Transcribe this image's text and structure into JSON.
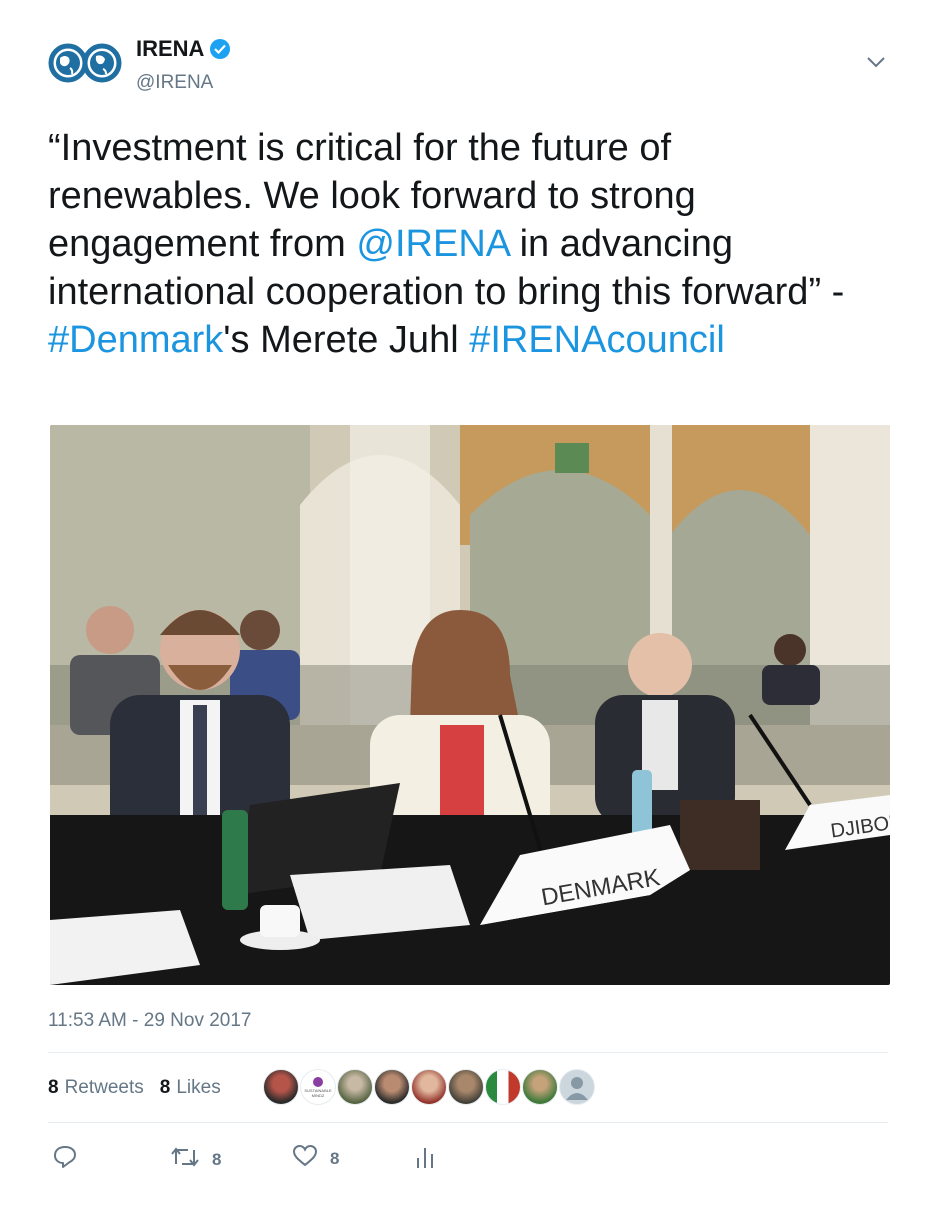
{
  "author": {
    "name": "IRENA",
    "handle": "@IRENA",
    "verified": true,
    "logo_icon": "irena-globe-logo"
  },
  "tweet": {
    "text_parts": [
      {
        "text": "“Investment is critical for the future of renewables. We look forward to strong engagement from ",
        "link": false
      },
      {
        "text": "@IRENA",
        "link": true
      },
      {
        "text": " in advancing international cooperation to bring this forward” - ",
        "link": false
      },
      {
        "text": "#Denmark",
        "link": true
      },
      {
        "text": "'s Merete Juhl ",
        "link": false
      },
      {
        "text": "#IRENAcouncil",
        "link": true
      }
    ],
    "photo": {
      "placards": [
        "DENMARK",
        "DJIBOU"
      ]
    },
    "timestamp": "11:53 AM - 29 Nov 2017"
  },
  "stats": {
    "retweets_count": "8",
    "retweets_label": "Retweets",
    "likes_count": "8",
    "likes_label": "Likes",
    "avatar_count": 9,
    "avatar_text": "SUSTAINABLE MINDZ"
  },
  "actions": {
    "reply_icon": "reply-icon",
    "retweet_icon": "retweet-icon",
    "retweet_count": "8",
    "like_icon": "heart-icon",
    "like_count": "8",
    "analytics_icon": "analytics-icon"
  },
  "colors": {
    "link": "#1b95e0",
    "verified": "#1da1f2",
    "meta": "#657786",
    "text": "#14171a",
    "divider": "#e6ecf0"
  }
}
